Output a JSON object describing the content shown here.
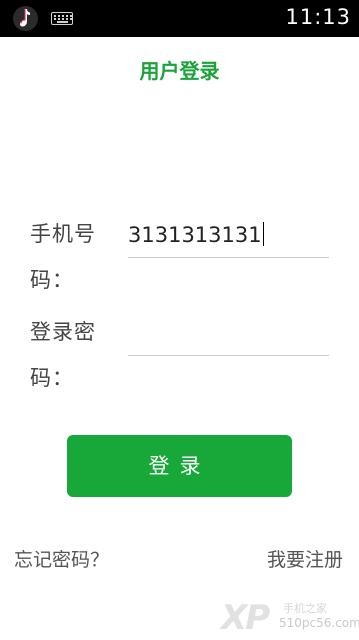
{
  "status_bar": {
    "time": "11:13",
    "app_icon": "tiktok-icon",
    "keyboard_icon": "keyboard-icon"
  },
  "page": {
    "title": "用户登录"
  },
  "form": {
    "phone_label": "手机号码：",
    "phone_value": "3131313131",
    "password_label": "登录密码：",
    "password_value": ""
  },
  "actions": {
    "login_label": "登录",
    "forgot_label": "忘记密码？",
    "register_label": "我要注册"
  },
  "watermark": {
    "logo": "XP",
    "line1": "手机之家",
    "line2": "510pc56.com"
  },
  "colors": {
    "accent": "#18a83a",
    "status_bar": "#000000"
  }
}
